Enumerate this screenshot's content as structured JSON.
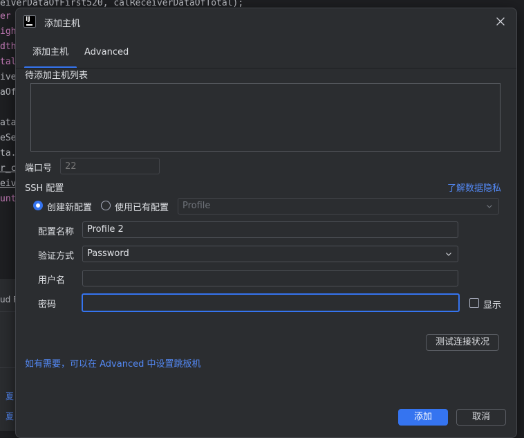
{
  "editor": {
    "lines": [
      "eiverDataOfFirst520, calReceiverDataOfTotal);",
      "er",
      "igh",
      "dth",
      "tal",
      "ive",
      "aOf",
      "",
      "ata",
      "eSe",
      "ta.",
      "r_c",
      "eiv",
      "unt"
    ],
    "panel_lines": [
      "ud F",
      "夏",
      "夏"
    ]
  },
  "dialog": {
    "app_icon_text": "IJ",
    "title": "添加主机",
    "tabs": [
      "添加主机",
      "Advanced"
    ],
    "active_tab": "添加主机",
    "host_list_label": "待添加主机列表",
    "port_label": "端口号",
    "port_placeholder": "22",
    "ssh_config_label": "SSH 配置",
    "privacy_link": "了解数据隐私",
    "radio_new_label": "创建新配置",
    "radio_existing_label": "使用已有配置",
    "radio_selected": "创建新配置",
    "existing_profile_value": "Profile",
    "config_name_label": "配置名称",
    "config_name_value": "Profile 2",
    "auth_label": "验证方式",
    "auth_value": "Password",
    "username_label": "用户名",
    "username_value": "",
    "password_label": "密码",
    "password_value": "",
    "show_label": "显示",
    "show_checked": false,
    "test_button": "测试连接状况",
    "advanced_hint": "如有需要，可以在 Advanced 中设置跳板机",
    "add_button": "添加",
    "cancel_button": "取消"
  },
  "colors": {
    "accent": "#3574f0",
    "link": "#548af7",
    "dialog_bg": "#2b2d30",
    "editor_bg": "#1e1f22"
  }
}
